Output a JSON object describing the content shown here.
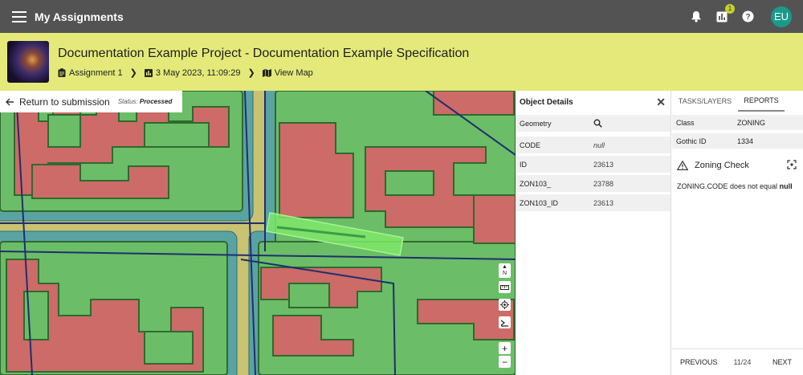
{
  "app": {
    "title": "My Assignments",
    "notification_count": "1",
    "avatar_initials": "EU"
  },
  "header": {
    "project_title": "Documentation Example Project - Documentation Example Specification",
    "breadcrumbs": [
      {
        "label": "Assignment 1",
        "icon": "clipboard-icon"
      },
      {
        "label": "3 May 2023, 11:09:29",
        "icon": "chart-icon"
      },
      {
        "label": "View Map",
        "icon": "map-icon"
      }
    ]
  },
  "map": {
    "back_label": "Return to submission",
    "status_prefix": "Status:",
    "status_value": "Processed",
    "controls": {
      "north": "N",
      "zoom_in": "+",
      "zoom_out": "−"
    }
  },
  "object_details": {
    "title": "Object Details",
    "geometry_label": "Geometry",
    "rows": [
      {
        "key": "CODE",
        "value": "null"
      },
      {
        "key": "ID",
        "value": "23613"
      },
      {
        "key": "ZON103_",
        "value": "23788"
      },
      {
        "key": "ZON103_ID",
        "value": "23613"
      }
    ]
  },
  "right_panel": {
    "tabs": [
      "TASKS/LAYERS",
      "REPORTS"
    ],
    "active_tab": "REPORTS",
    "props": [
      {
        "key": "Class",
        "value": "ZONING"
      },
      {
        "key": "Gothic ID",
        "value": "1334"
      }
    ],
    "check_title": "Zoning Check",
    "message_text": "ZONING.CODE does not equal",
    "message_bold": "null",
    "pagination": {
      "prev": "PREVIOUS",
      "page": "11/24",
      "next": "NEXT"
    }
  },
  "colors": {
    "topbar": "#535353",
    "header": "#e4e97a",
    "avatar": "#1a9a8a",
    "badge": "#c4d22d",
    "map_green": "#6bbd67",
    "map_red": "#cc6b67",
    "map_teal": "#5aa3a3",
    "map_yellow": "#c9c271",
    "highlight": "#7ee86a"
  }
}
